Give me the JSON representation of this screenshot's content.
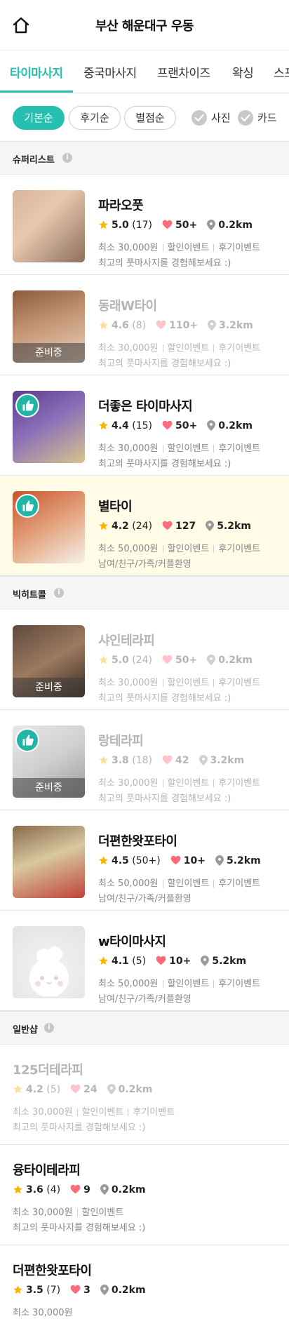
{
  "header": {
    "title": "부산 해운대구 우동",
    "home_icon": "home-icon"
  },
  "tabs": [
    "타이마사지",
    "중국마사지",
    "프랜차이즈",
    "왁싱",
    "스포"
  ],
  "filters": {
    "sort": [
      "기본순",
      "후기순",
      "별점순"
    ],
    "checks": [
      "사진",
      "카드"
    ]
  },
  "colors": {
    "accent": "#26c0b0",
    "star": "#f7b500",
    "heart": "#ff6b7a",
    "highlight": "#fffbe6"
  },
  "sections": [
    {
      "title": "슈퍼리스트",
      "items": [
        {
          "name": "파라오풋",
          "rating": "5.0",
          "reviews": "(17)",
          "likes": "50+",
          "distance": "0.2km",
          "price": "최소 30,000원",
          "tags": [
            "할인이벤트",
            "후기이벤트"
          ],
          "desc": "최고의 풋마사지를 경험해보세요 :)",
          "overlay": "",
          "badge": false,
          "dim": false,
          "highlight": false
        },
        {
          "name": "동래W타이",
          "rating": "4.6",
          "reviews": "(8)",
          "likes": "110+",
          "distance": "3.2km",
          "price": "최소 30,000원",
          "tags": [
            "할인이벤트",
            "후기이벤트"
          ],
          "desc": "최고의 풋마사지를 경험해보세요 :)",
          "overlay": "준비중",
          "badge": false,
          "dim": true,
          "highlight": false
        },
        {
          "name": "더좋은 타이마사지",
          "rating": "4.4",
          "reviews": "(15)",
          "likes": "50+",
          "distance": "0.2km",
          "price": "최소 30,000원",
          "tags": [
            "할인이벤트",
            "후기이벤트"
          ],
          "desc": "최고의 풋마사지를 경험해보세요 :)",
          "overlay": "",
          "badge": true,
          "dim": false,
          "highlight": false
        },
        {
          "name": "별타이",
          "rating": "4.2",
          "reviews": "(24)",
          "likes": "127",
          "distance": "5.2km",
          "price": "최소 50,000원",
          "tags": [
            "할인이벤트",
            "후기이벤트"
          ],
          "desc": "남여/친구/가족/커플환영",
          "overlay": "",
          "badge": true,
          "dim": false,
          "highlight": true
        }
      ]
    },
    {
      "title": "빅히트콜",
      "items": [
        {
          "name": "샤인테라피",
          "rating": "5.0",
          "reviews": "(24)",
          "likes": "50+",
          "distance": "0.2km",
          "price": "최소 30,000원",
          "tags": [
            "할인이벤트",
            "후기이벤트"
          ],
          "desc": "최고의 풋마사지를 경험해보세요 :)",
          "overlay": "준비중",
          "badge": false,
          "dim": true,
          "highlight": false
        },
        {
          "name": "랑테라피",
          "rating": "3.8",
          "reviews": "(18)",
          "likes": "42",
          "distance": "3.2km",
          "price": "최소 30,000원",
          "tags": [
            "할인이벤트",
            "후기이벤트"
          ],
          "desc": "최고의 풋마사지를 경험해보세요 :)",
          "overlay": "준비중",
          "badge": true,
          "dim": true,
          "highlight": false
        },
        {
          "name": "더편한왓포타이",
          "rating": "4.5",
          "reviews": "(50+)",
          "likes": "10+",
          "distance": "5.2km",
          "price": "최소 50,000원",
          "tags": [
            "할인이벤트",
            "후기이벤트"
          ],
          "desc": "남여/친구/가족/커플환영",
          "overlay": "",
          "badge": false,
          "dim": false,
          "highlight": false
        },
        {
          "name": "w타이마사지",
          "rating": "4.1",
          "reviews": "(5)",
          "likes": "10+",
          "distance": "5.2km",
          "price": "최소 50,000원",
          "tags": [
            "할인이벤트",
            "후기이벤트"
          ],
          "desc": "남여/친구/가족/커플환영",
          "overlay": "",
          "badge": false,
          "dim": false,
          "highlight": false
        }
      ]
    },
    {
      "title": "일반샵",
      "items": [
        {
          "name": "125더테라피",
          "rating": "4.2",
          "reviews": "(5)",
          "likes": "24",
          "distance": "0.2km",
          "price": "최소 30,000원",
          "tags": [
            "할인이벤트",
            "후기이벤트"
          ],
          "desc": "최고의 풋마사지를 경험해보세요 :)",
          "dim": true
        },
        {
          "name": "융타이테라피",
          "rating": "3.6",
          "reviews": "(4)",
          "likes": "9",
          "distance": "0.2km",
          "price": "최소 30,000원",
          "tags": [
            "할인이벤트"
          ],
          "desc": "최고의 풋마사지를 경험해보세요 :)",
          "dim": false
        },
        {
          "name": "더편한왓포타이",
          "rating": "3.5",
          "reviews": "(7)",
          "likes": "3",
          "distance": "0.2km",
          "price": "최소 30,000원",
          "tags": [],
          "desc": "",
          "dim": false
        }
      ]
    }
  ]
}
